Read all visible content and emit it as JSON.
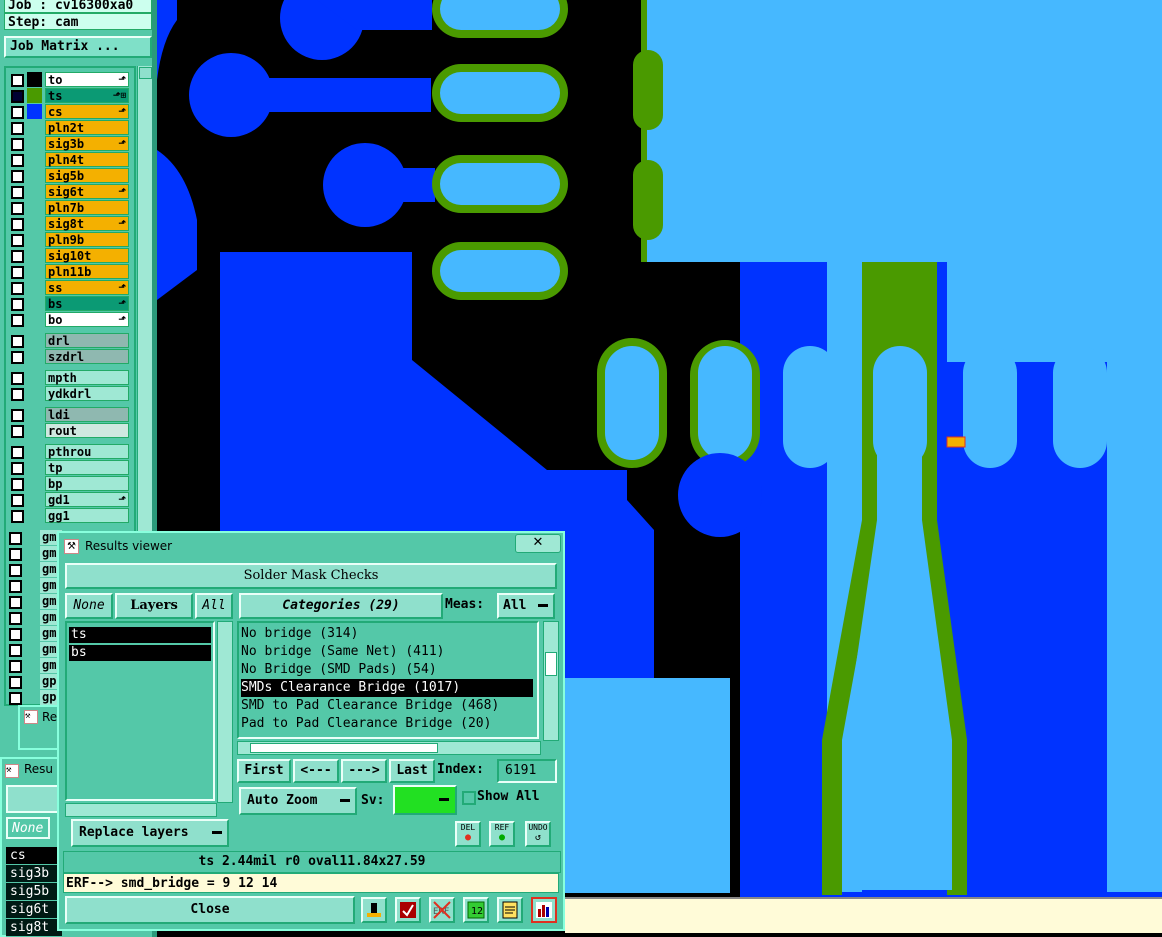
{
  "left_panel": {
    "job_label": "Job : cv16300xa0",
    "step_label": "Step: cam",
    "job_matrix_button": "Job Matrix ...",
    "layers": [
      {
        "name": "to",
        "color": "#ffffff",
        "swatch": "#000000",
        "mark": "⬏"
      },
      {
        "name": "ts",
        "color": "#0b9a74",
        "swatch": "#4a9a00",
        "mark": "⬏⊞",
        "selected": true
      },
      {
        "name": "cs",
        "color": "#f4b000",
        "swatch": "#0033ff",
        "mark": "⬏"
      },
      {
        "name": "pln2t",
        "color": "#f4b000",
        "swatch": "",
        "mark": ""
      },
      {
        "name": "sig3b",
        "color": "#f4b000",
        "swatch": "",
        "mark": "⬏"
      },
      {
        "name": "pln4t",
        "color": "#f4b000",
        "swatch": "",
        "mark": ""
      },
      {
        "name": "sig5b",
        "color": "#f4b000",
        "swatch": "",
        "mark": ""
      },
      {
        "name": "sig6t",
        "color": "#f4b000",
        "swatch": "",
        "mark": "⬏"
      },
      {
        "name": "pln7b",
        "color": "#f4b000",
        "swatch": "",
        "mark": ""
      },
      {
        "name": "sig8t",
        "color": "#f4b000",
        "swatch": "",
        "mark": "⬏"
      },
      {
        "name": "pln9b",
        "color": "#f4b000",
        "swatch": "",
        "mark": ""
      },
      {
        "name": "sig10t",
        "color": "#f4b000",
        "swatch": "",
        "mark": ""
      },
      {
        "name": "pln11b",
        "color": "#f4b000",
        "swatch": "",
        "mark": ""
      },
      {
        "name": "ss",
        "color": "#f4b000",
        "swatch": "",
        "mark": "⬏"
      },
      {
        "name": "bs",
        "color": "#0b9a74",
        "swatch": "",
        "mark": "⬏"
      },
      {
        "name": "bo",
        "color": "#ffffff",
        "swatch": "",
        "mark": "⬏"
      },
      {
        "name": "drl",
        "color": "#8fb8b0",
        "swatch": "",
        "mark": ""
      },
      {
        "name": "szdrl",
        "color": "#8fb8b0",
        "swatch": "",
        "mark": ""
      },
      {
        "name": "mpth",
        "color": "#9fe8d4",
        "swatch": "",
        "mark": ""
      },
      {
        "name": "ydkdrl",
        "color": "#9fe8d4",
        "swatch": "",
        "mark": ""
      },
      {
        "name": "ldi",
        "color": "#8fb8b0",
        "swatch": "",
        "mark": ""
      },
      {
        "name": "rout",
        "color": "#cfe8e0",
        "swatch": "",
        "mark": ""
      },
      {
        "name": "pthrou",
        "color": "#9fe8d4",
        "swatch": "",
        "mark": ""
      },
      {
        "name": "tp",
        "color": "#9fe8d4",
        "swatch": "",
        "mark": ""
      },
      {
        "name": "bp",
        "color": "#9fe8d4",
        "swatch": "",
        "mark": ""
      },
      {
        "name": "gd1",
        "color": "#9fe8d4",
        "swatch": "",
        "mark": "⬏"
      },
      {
        "name": "gg1",
        "color": "#9fe8d4",
        "swatch": "",
        "mark": ""
      }
    ],
    "partial_layer_labels": [
      "gm",
      "gm",
      "gm",
      "gm",
      "gm",
      "gm",
      "gm",
      "gm",
      "gm",
      "gp",
      "gp"
    ],
    "behind_window_title": "Re",
    "behind_window2_title": "Resu",
    "behind_none": "None",
    "behind_layers": [
      "cs",
      "sig3b",
      "sig5b",
      "sig6t",
      "sig8t"
    ]
  },
  "results_viewer": {
    "title": "Results viewer",
    "header": "Solder Mask Checks",
    "none_btn": "None",
    "layers_btn": "Layers",
    "all_btn": "All",
    "categories_btn": "Categories (29)",
    "meas_label": "Meas:",
    "meas_value": "All",
    "layers": [
      "ts",
      "bs"
    ],
    "categories": [
      {
        "text": "No bridge (314)",
        "selected": false
      },
      {
        "text": "No bridge (Same Net) (411)",
        "selected": false
      },
      {
        "text": "No Bridge (SMD Pads) (54)",
        "selected": false
      },
      {
        "text": "SMDs Clearance Bridge (1017)",
        "selected": true
      },
      {
        "text": "SMD to Pad Clearance Bridge (468)",
        "selected": false
      },
      {
        "text": "Pad to Pad Clearance Bridge (20)",
        "selected": false
      }
    ],
    "first_btn": "First",
    "prev_btn": "<---",
    "next_btn": "--->",
    "last_btn": "Last",
    "index_label": "Index:",
    "index_value": "6191",
    "auto_zoom": "Auto Zoom",
    "sv_label": "Sv:",
    "show_all": "Show All",
    "replace_layers": "Replace layers",
    "del_icon": "DEL",
    "ref_icon": "REF",
    "undo_icon": "UNDO",
    "status": "ts 2.44mil  r0  oval11.84x27.59",
    "erf": "ERF--> smd_bridge = 9 12 14",
    "close_btn": "Close",
    "sv_color": "#22e022"
  }
}
